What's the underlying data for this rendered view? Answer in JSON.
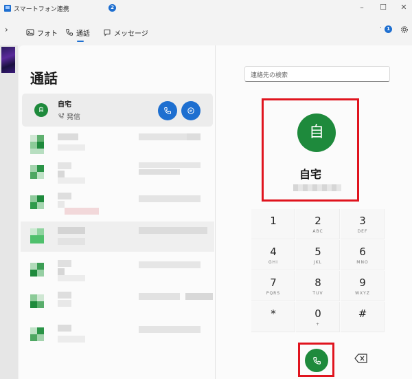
{
  "window": {
    "title": "スマートフォン連携"
  },
  "nav": {
    "tabs": [
      {
        "label": "フォト",
        "icon": "photo-icon"
      },
      {
        "label": "通話",
        "icon": "phone-icon"
      },
      {
        "label": "メッセージ",
        "icon": "message-icon"
      }
    ],
    "message_badge": "2",
    "notification_badge": "1"
  },
  "calls": {
    "heading": "通話",
    "selected": {
      "avatar": "自",
      "name": "自宅",
      "status": "発信"
    }
  },
  "dialer": {
    "search_placeholder": "連絡先の検索",
    "contact_avatar": "自",
    "contact_name": "自宅",
    "keys": [
      {
        "digit": "1",
        "letters": ""
      },
      {
        "digit": "2",
        "letters": "ABC"
      },
      {
        "digit": "3",
        "letters": "DEF"
      },
      {
        "digit": "4",
        "letters": "GHI"
      },
      {
        "digit": "5",
        "letters": "JKL"
      },
      {
        "digit": "6",
        "letters": "MNO"
      },
      {
        "digit": "7",
        "letters": "PQRS"
      },
      {
        "digit": "8",
        "letters": "TUV"
      },
      {
        "digit": "9",
        "letters": "WXYZ"
      },
      {
        "digit": "*",
        "letters": ""
      },
      {
        "digit": "0",
        "letters": "+"
      },
      {
        "digit": "#",
        "letters": ""
      }
    ]
  },
  "colors": {
    "accent": "#1e6fd0",
    "call_green": "#1e8a3c",
    "highlight_red": "#e0141e"
  }
}
